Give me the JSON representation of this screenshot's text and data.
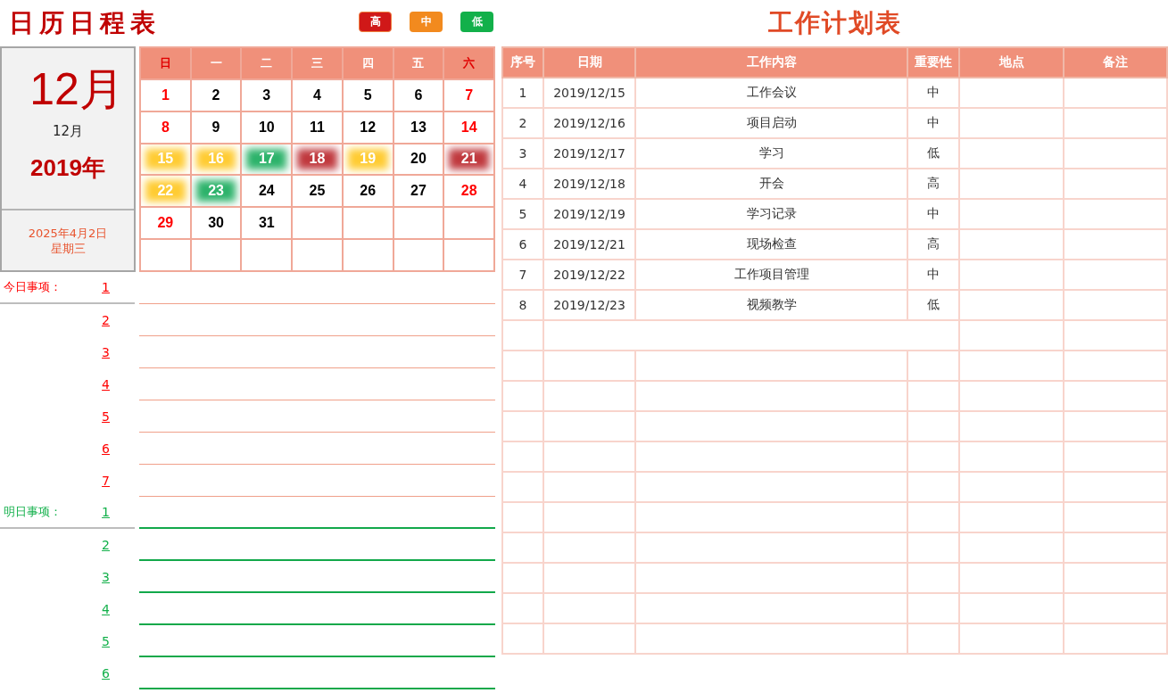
{
  "title": "日历日程表",
  "legend": [
    {
      "label": "高",
      "kind": "high"
    },
    {
      "label": "中",
      "kind": "mid"
    },
    {
      "label": "低",
      "kind": "low"
    }
  ],
  "month_panel": {
    "month_large": "12月",
    "month_small": "12月",
    "year": "2019年",
    "today_date": "2025年4月2日",
    "weekday": "星期三"
  },
  "calendar": {
    "weekdays": [
      {
        "label": "日",
        "weekend": true
      },
      {
        "label": "一",
        "weekend": false
      },
      {
        "label": "二",
        "weekend": false
      },
      {
        "label": "三",
        "weekend": false
      },
      {
        "label": "四",
        "weekend": false
      },
      {
        "label": "五",
        "weekend": false
      },
      {
        "label": "六",
        "weekend": true
      }
    ],
    "days": [
      {
        "label": "1",
        "kind": "plain"
      },
      {
        "label": "2",
        "kind": "plain"
      },
      {
        "label": "3",
        "kind": "plain"
      },
      {
        "label": "4",
        "kind": "plain"
      },
      {
        "label": "5",
        "kind": "plain"
      },
      {
        "label": "6",
        "kind": "plain"
      },
      {
        "label": "7",
        "kind": "plain"
      },
      {
        "label": "8",
        "kind": "plain"
      },
      {
        "label": "9",
        "kind": "plain"
      },
      {
        "label": "10",
        "kind": "plain"
      },
      {
        "label": "11",
        "kind": "plain"
      },
      {
        "label": "12",
        "kind": "plain"
      },
      {
        "label": "13",
        "kind": "plain"
      },
      {
        "label": "14",
        "kind": "plain"
      },
      {
        "label": "15",
        "kind": "mid"
      },
      {
        "label": "16",
        "kind": "mid"
      },
      {
        "label": "17",
        "kind": "low"
      },
      {
        "label": "18",
        "kind": "high"
      },
      {
        "label": "19",
        "kind": "mid"
      },
      {
        "label": "20",
        "kind": "plain"
      },
      {
        "label": "21",
        "kind": "high"
      },
      {
        "label": "22",
        "kind": "mid"
      },
      {
        "label": "23",
        "kind": "low"
      },
      {
        "label": "24",
        "kind": "plain"
      },
      {
        "label": "25",
        "kind": "plain"
      },
      {
        "label": "26",
        "kind": "plain"
      },
      {
        "label": "27",
        "kind": "plain"
      },
      {
        "label": "28",
        "kind": "plain"
      },
      {
        "label": "29",
        "kind": "plain"
      },
      {
        "label": "30",
        "kind": "plain"
      },
      {
        "label": "31",
        "kind": "plain"
      }
    ]
  },
  "task_sections": [
    {
      "label": "今日事项：",
      "kind": "today",
      "items": [
        "1",
        "2",
        "3",
        "4",
        "5",
        "6",
        "7"
      ]
    },
    {
      "label": "明日事项：",
      "kind": "tomorrow",
      "items": [
        "1",
        "2",
        "3",
        "4",
        "5",
        "6"
      ]
    }
  ],
  "plan": {
    "title": "工作计划表",
    "columns": [
      "序号",
      "日期",
      "工作内容",
      "重要性",
      "地点",
      "备注"
    ],
    "rows": [
      {
        "no": "1",
        "date": "2019/12/15",
        "content": "工作会议",
        "importance": "中"
      },
      {
        "no": "2",
        "date": "2019/12/16",
        "content": "项目启动",
        "importance": "中"
      },
      {
        "no": "3",
        "date": "2019/12/17",
        "content": "学习",
        "importance": "低"
      },
      {
        "no": "4",
        "date": "2019/12/18",
        "content": "开会",
        "importance": "高"
      },
      {
        "no": "5",
        "date": "2019/12/19",
        "content": "学习记录",
        "importance": "中"
      },
      {
        "no": "6",
        "date": "2019/12/21",
        "content": "现场检查",
        "importance": "高"
      },
      {
        "no": "7",
        "date": "2019/12/22",
        "content": "工作项目管理",
        "importance": "中"
      },
      {
        "no": "8",
        "date": "2019/12/23",
        "content": "视频教学",
        "importance": "低"
      }
    ]
  }
}
